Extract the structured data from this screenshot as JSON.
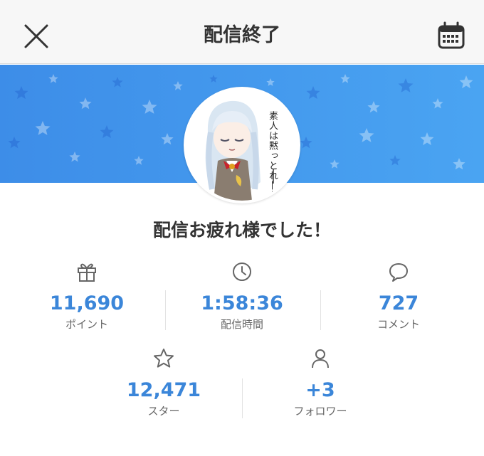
{
  "header": {
    "title": "配信終了",
    "close_icon": "close-icon",
    "calendar_icon": "calendar-icon"
  },
  "banner": {
    "color_start": "#3d8de8",
    "color_end": "#4aa4f2",
    "decoration": "star-pattern"
  },
  "avatar": {
    "caption": "素人は黙っとれ——"
  },
  "headline": "配信お疲れ様でした！",
  "stats": {
    "points": {
      "value": "11,690",
      "label": "ポイント",
      "icon": "gift-icon"
    },
    "duration": {
      "value": "1:58:36",
      "label": "配信時間",
      "icon": "clock-icon"
    },
    "comments": {
      "value": "727",
      "label": "コメント",
      "icon": "comment-icon"
    },
    "stars": {
      "value": "12,471",
      "label": "スター",
      "icon": "star-icon"
    },
    "followers": {
      "value": "+3",
      "label": "フォロワー",
      "icon": "person-icon"
    }
  },
  "colors": {
    "accent": "#3b86d9",
    "text": "#333333",
    "muted": "#666666"
  }
}
